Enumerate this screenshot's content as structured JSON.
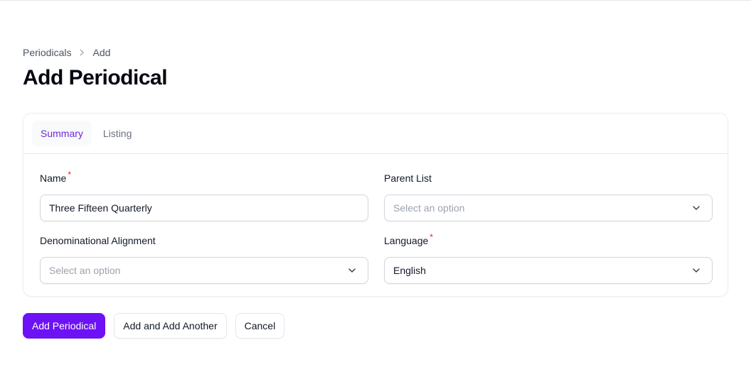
{
  "breadcrumb": {
    "parent": "Periodicals",
    "current": "Add"
  },
  "page": {
    "title": "Add Periodical"
  },
  "tabs": [
    {
      "label": "Summary",
      "active": true
    },
    {
      "label": "Listing",
      "active": false
    }
  ],
  "form": {
    "name": {
      "label": "Name",
      "required_mark": "*",
      "value": "Three Fifteen Quarterly"
    },
    "parent_list": {
      "label": "Parent List",
      "placeholder": "Select an option"
    },
    "denominational_alignment": {
      "label": "Denominational Alignment",
      "placeholder": "Select an option"
    },
    "language": {
      "label": "Language",
      "required_mark": "*",
      "value": "English"
    }
  },
  "actions": {
    "create": "Add Periodical",
    "create_another": "Add and Add Another",
    "cancel": "Cancel"
  },
  "colors": {
    "accent": "#6d12f5",
    "tab_active_text": "#6d28d9",
    "required": "#dc2626"
  },
  "icons": {
    "breadcrumb_separator": "chevron-right-icon",
    "select_arrow": "chevron-down-icon"
  }
}
